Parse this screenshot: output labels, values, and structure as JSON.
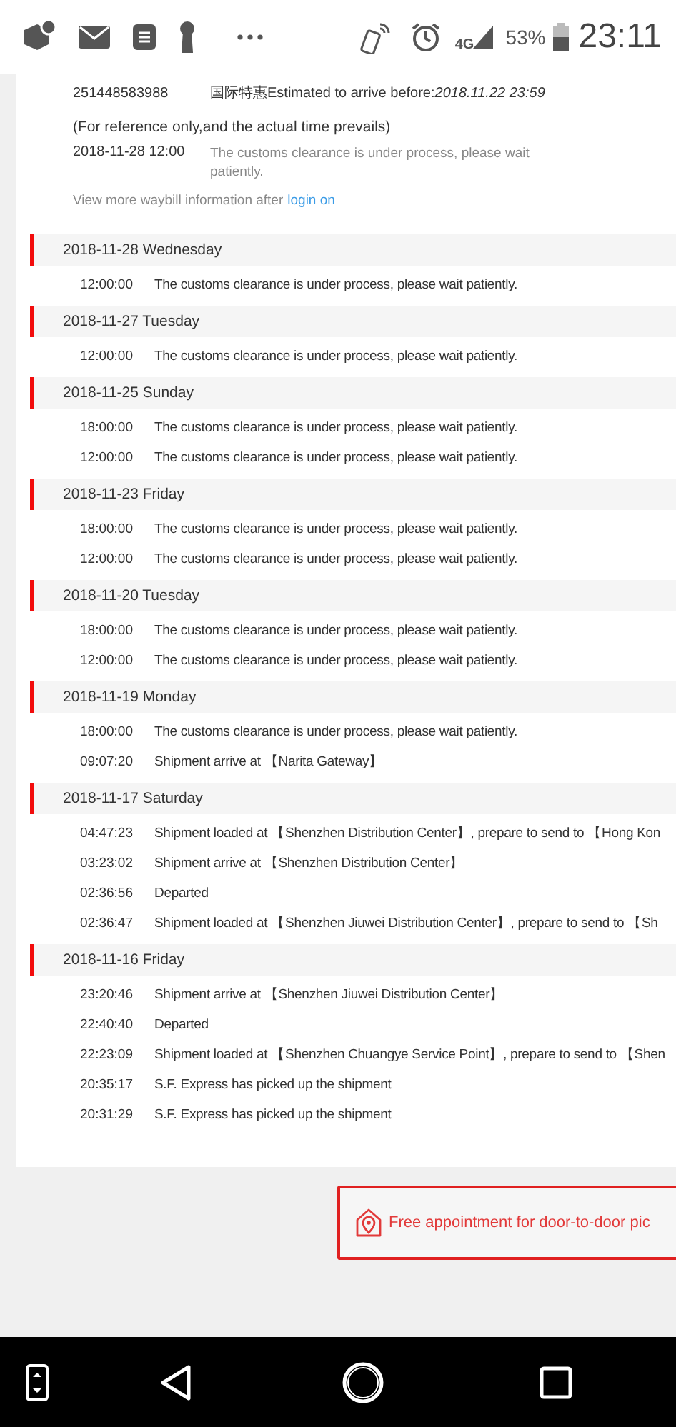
{
  "status_bar": {
    "network": "4G",
    "battery": "53%",
    "time": "23:11"
  },
  "waybill": {
    "number": "251448583988",
    "service": "国际特惠Estimated to arrive before:*2018.11.22 23:59*",
    "note": "(For reference only,and the actual time prevails)",
    "latest_time": "2018-11-28 12:00",
    "latest_text": "The customs clearance is under process, please wait patiently.",
    "more_text": "View more waybill information after",
    "more_link": "login on"
  },
  "days": [
    {
      "date": "2018-11-28 Wednesday",
      "events": [
        {
          "time": "12:00:00",
          "text": "The customs clearance is under process, please wait patiently."
        }
      ]
    },
    {
      "date": "2018-11-27 Tuesday",
      "events": [
        {
          "time": "12:00:00",
          "text": "The customs clearance is under process, please wait patiently."
        }
      ]
    },
    {
      "date": "2018-11-25 Sunday",
      "events": [
        {
          "time": "18:00:00",
          "text": "The customs clearance is under process, please wait patiently."
        },
        {
          "time": "12:00:00",
          "text": "The customs clearance is under process, please wait patiently."
        }
      ]
    },
    {
      "date": "2018-11-23 Friday",
      "events": [
        {
          "time": "18:00:00",
          "text": "The customs clearance is under process, please wait patiently."
        },
        {
          "time": "12:00:00",
          "text": "The customs clearance is under process, please wait patiently."
        }
      ]
    },
    {
      "date": "2018-11-20 Tuesday",
      "events": [
        {
          "time": "18:00:00",
          "text": "The customs clearance is under process, please wait patiently."
        },
        {
          "time": "12:00:00",
          "text": "The customs clearance is under process, please wait patiently."
        }
      ]
    },
    {
      "date": "2018-11-19 Monday",
      "events": [
        {
          "time": "18:00:00",
          "text": "The customs clearance is under process, please wait patiently."
        },
        {
          "time": "09:07:20",
          "text": "Shipment arrive at 【Narita Gateway】"
        }
      ]
    },
    {
      "date": "2018-11-17 Saturday",
      "events": [
        {
          "time": "04:47:23",
          "text": "Shipment loaded at 【Shenzhen Distribution Center】, prepare to send to 【Hong Kon"
        },
        {
          "time": "03:23:02",
          "text": "Shipment arrive at 【Shenzhen Distribution Center】"
        },
        {
          "time": "02:36:56",
          "text": "Departed"
        },
        {
          "time": "02:36:47",
          "text": "Shipment loaded at 【Shenzhen Jiuwei Distribution Center】, prepare to send to 【Sh"
        }
      ]
    },
    {
      "date": "2018-11-16 Friday",
      "events": [
        {
          "time": "23:20:46",
          "text": "Shipment arrive at 【Shenzhen Jiuwei Distribution Center】"
        },
        {
          "time": "22:40:40",
          "text": "Departed"
        },
        {
          "time": "22:23:09",
          "text": "Shipment loaded at 【Shenzhen Chuangye Service Point】, prepare to send to 【Shen"
        },
        {
          "time": "20:35:17",
          "text": "S.F. Express has picked up the shipment"
        },
        {
          "time": "20:31:29",
          "text": "S.F. Express has picked up the shipment"
        }
      ]
    }
  ],
  "pickup_button": {
    "label": "Free appointment for door-to-door pic"
  }
}
